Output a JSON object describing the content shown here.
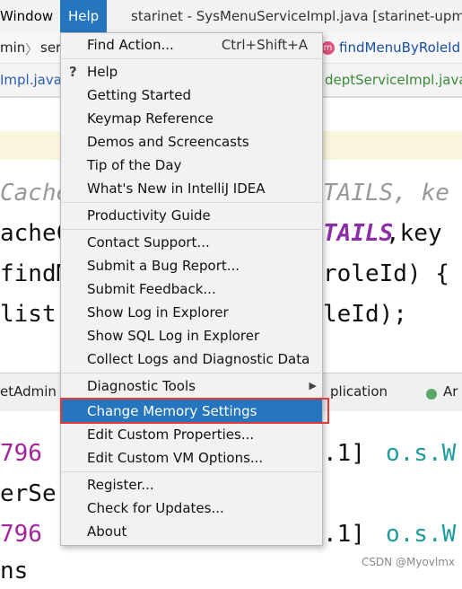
{
  "menubar": {
    "window_label": "Window",
    "help_label": "Help",
    "window_title": "starinet - SysMenuServiceImpl.java [starinet-upms-"
  },
  "breadcrumb": {
    "item1": "min",
    "item2": "ser",
    "method": "findMenuByRoleId",
    "badge": "m"
  },
  "tabs": {
    "left": "Impl.java",
    "right": "deptServiceImpl.java"
  },
  "editor": {
    "lines": [
      {
        "a": "Cache(",
        "b": "",
        "c": "TAILS, ke"
      },
      {
        "a": "acheC",
        "b": "TAILS",
        "c": ",key"
      },
      {
        "a": "findM",
        "b": "",
        "c": "roleId) {"
      },
      {
        "a": "list",
        "b": "",
        "c": "leId);"
      }
    ]
  },
  "panel": {
    "left_tab": "etAdmin",
    "mid_tab": "plication",
    "right_tab": "Ar"
  },
  "console": {
    "line1_num": "796 -",
    "line1_mid": ".1]",
    "line1_end": "o.s.W",
    "line2": "erSer",
    "line3_num": "796 -",
    "line3_mid": ".1]",
    "line3_end": "o.s.W",
    "line4": "ns"
  },
  "help_menu": {
    "items": [
      {
        "label": "Find Action...",
        "shortcut": "Ctrl+Shift+A"
      },
      {
        "label": "Help"
      },
      {
        "label": "Getting Started"
      },
      {
        "label": "Keymap Reference"
      },
      {
        "label": "Demos and Screencasts"
      },
      {
        "label": "Tip of the Day"
      },
      {
        "label": "What's New in IntelliJ IDEA"
      },
      {
        "label": "Productivity Guide"
      },
      {
        "label": "Contact Support..."
      },
      {
        "label": "Submit a Bug Report..."
      },
      {
        "label": "Submit Feedback..."
      },
      {
        "label": "Show Log in Explorer"
      },
      {
        "label": "Show SQL Log in Explorer"
      },
      {
        "label": "Collect Logs and Diagnostic Data"
      },
      {
        "label": "Diagnostic Tools"
      },
      {
        "label": "Change Memory Settings"
      },
      {
        "label": "Edit Custom Properties..."
      },
      {
        "label": "Edit Custom VM Options..."
      },
      {
        "label": "Register..."
      },
      {
        "label": "Check for Updates..."
      },
      {
        "label": "About"
      }
    ]
  },
  "watermark": "CSDN @Myovlmx",
  "colors": {
    "accent": "#2675bf",
    "highlight_box": "#e53935",
    "keyword_purple": "#8b2fa8",
    "console_num": "#a3249b",
    "console_class": "#1c9c9c"
  }
}
